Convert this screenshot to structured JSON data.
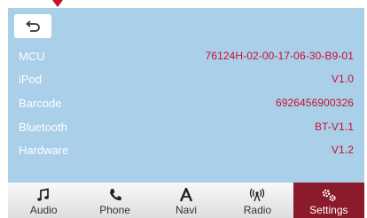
{
  "info_rows": [
    {
      "label": "MCU",
      "value": "76124H-02-00-17-06-30-B9-01"
    },
    {
      "label": "iPod",
      "value": "V1.0"
    },
    {
      "label": "Barcode",
      "value": "6926456900326"
    },
    {
      "label": "Bluetooth",
      "value": "BT-V1.1"
    },
    {
      "label": "Hardware",
      "value": "V1.2"
    }
  ],
  "tabs": [
    {
      "label": "Audio",
      "icon": "music-note-icon"
    },
    {
      "label": "Phone",
      "icon": "phone-icon"
    },
    {
      "label": "Navi",
      "icon": "navigation-a-icon"
    },
    {
      "label": "Radio",
      "icon": "radio-antenna-icon"
    },
    {
      "label": "Settings",
      "icon": "gears-icon",
      "active": true
    }
  ],
  "colors": {
    "screen_bg": "#a9cfe9",
    "value_text": "#c8102e",
    "active_tab_bg": "#8b1a2a"
  }
}
